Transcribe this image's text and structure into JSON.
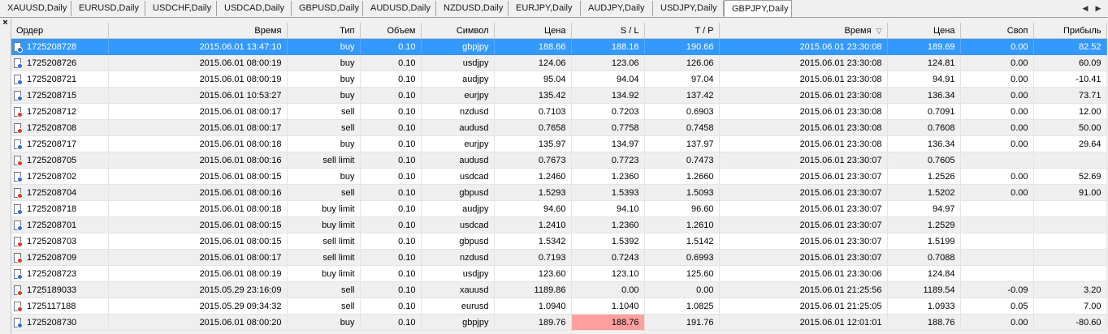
{
  "tabs": [
    "XAUUSD,Daily",
    "EURUSD,Daily",
    "USDCHF,Daily",
    "USDCAD,Daily",
    "GBPUSD,Daily",
    "AUDUSD,Daily",
    "NZDUSD,Daily",
    "EURJPY,Daily",
    "AUDJPY,Daily",
    "USDJPY,Daily",
    "GBPJPY,Daily"
  ],
  "active_tab": "GBPJPY,Daily",
  "nav": {
    "left": "◀",
    "right": "▶"
  },
  "close_glyph": "×",
  "columns": [
    "Ордер",
    "Время",
    "Тип",
    "Объем",
    "Символ",
    "Цена",
    "S / L",
    "T / P",
    "Время",
    "Цена",
    "Своп",
    "Прибыль"
  ],
  "sort_indicator": "▽",
  "colors": {
    "selected_row": "#3399ff",
    "sl_highlight": "#ff9f9f",
    "buy_icon": "#2c6fd8",
    "sell_icon": "#e03a1e"
  },
  "rows": [
    {
      "order": "1725208728",
      "time": "2015.06.01 13:47:10",
      "type": "buy",
      "volume": "0.10",
      "symbol": "gbpjpy",
      "price": "188.66",
      "sl": "188.16",
      "tp": "190.66",
      "time2": "2015.06.01 23:30:08",
      "price2": "189.69",
      "swap": "0.00",
      "profit": "82.52"
    },
    {
      "order": "1725208726",
      "time": "2015.06.01 08:00:19",
      "type": "buy",
      "volume": "0.10",
      "symbol": "usdjpy",
      "price": "124.06",
      "sl": "123.06",
      "tp": "126.06",
      "time2": "2015.06.01 23:30:08",
      "price2": "124.81",
      "swap": "0.00",
      "profit": "60.09"
    },
    {
      "order": "1725208721",
      "time": "2015.06.01 08:00:19",
      "type": "buy",
      "volume": "0.10",
      "symbol": "audjpy",
      "price": "95.04",
      "sl": "94.04",
      "tp": "97.04",
      "time2": "2015.06.01 23:30:08",
      "price2": "94.91",
      "swap": "0.00",
      "profit": "-10.41"
    },
    {
      "order": "1725208715",
      "time": "2015.06.01 10:53:27",
      "type": "buy",
      "volume": "0.10",
      "symbol": "eurjpy",
      "price": "135.42",
      "sl": "134.92",
      "tp": "137.42",
      "time2": "2015.06.01 23:30:08",
      "price2": "136.34",
      "swap": "0.00",
      "profit": "73.71"
    },
    {
      "order": "1725208712",
      "time": "2015.06.01 08:00:17",
      "type": "sell",
      "volume": "0.10",
      "symbol": "nzdusd",
      "price": "0.7103",
      "sl": "0.7203",
      "tp": "0.6903",
      "time2": "2015.06.01 23:30:08",
      "price2": "0.7091",
      "swap": "0.00",
      "profit": "12.00"
    },
    {
      "order": "1725208708",
      "time": "2015.06.01 08:00:17",
      "type": "sell",
      "volume": "0.10",
      "symbol": "audusd",
      "price": "0.7658",
      "sl": "0.7758",
      "tp": "0.7458",
      "time2": "2015.06.01 23:30:08",
      "price2": "0.7608",
      "swap": "0.00",
      "profit": "50.00"
    },
    {
      "order": "1725208717",
      "time": "2015.06.01 08:00:18",
      "type": "buy",
      "volume": "0.10",
      "symbol": "eurjpy",
      "price": "135.97",
      "sl": "134.97",
      "tp": "137.97",
      "time2": "2015.06.01 23:30:08",
      "price2": "136.34",
      "swap": "0.00",
      "profit": "29.64"
    },
    {
      "order": "1725208705",
      "time": "2015.06.01 08:00:16",
      "type": "sell limit",
      "volume": "0.10",
      "symbol": "audusd",
      "price": "0.7673",
      "sl": "0.7723",
      "tp": "0.7473",
      "time2": "2015.06.01 23:30:07",
      "price2": "0.7605",
      "swap": "",
      "profit": ""
    },
    {
      "order": "1725208702",
      "time": "2015.06.01 08:00:15",
      "type": "buy",
      "volume": "0.10",
      "symbol": "usdcad",
      "price": "1.2460",
      "sl": "1.2360",
      "tp": "1.2660",
      "time2": "2015.06.01 23:30:07",
      "price2": "1.2526",
      "swap": "0.00",
      "profit": "52.69"
    },
    {
      "order": "1725208704",
      "time": "2015.06.01 08:00:16",
      "type": "sell",
      "volume": "0.10",
      "symbol": "gbpusd",
      "price": "1.5293",
      "sl": "1.5393",
      "tp": "1.5093",
      "time2": "2015.06.01 23:30:07",
      "price2": "1.5202",
      "swap": "0.00",
      "profit": "91.00"
    },
    {
      "order": "1725208718",
      "time": "2015.06.01 08:00:18",
      "type": "buy limit",
      "volume": "0.10",
      "symbol": "audjpy",
      "price": "94.60",
      "sl": "94.10",
      "tp": "96.60",
      "time2": "2015.06.01 23:30:07",
      "price2": "94.97",
      "swap": "",
      "profit": ""
    },
    {
      "order": "1725208701",
      "time": "2015.06.01 08:00:15",
      "type": "buy limit",
      "volume": "0.10",
      "symbol": "usdcad",
      "price": "1.2410",
      "sl": "1.2360",
      "tp": "1.2610",
      "time2": "2015.06.01 23:30:07",
      "price2": "1.2529",
      "swap": "",
      "profit": ""
    },
    {
      "order": "1725208703",
      "time": "2015.06.01 08:00:15",
      "type": "sell limit",
      "volume": "0.10",
      "symbol": "gbpusd",
      "price": "1.5342",
      "sl": "1.5392",
      "tp": "1.5142",
      "time2": "2015.06.01 23:30:07",
      "price2": "1.5199",
      "swap": "",
      "profit": ""
    },
    {
      "order": "1725208709",
      "time": "2015.06.01 08:00:17",
      "type": "sell limit",
      "volume": "0.10",
      "symbol": "nzdusd",
      "price": "0.7193",
      "sl": "0.7243",
      "tp": "0.6993",
      "time2": "2015.06.01 23:30:07",
      "price2": "0.7088",
      "swap": "",
      "profit": ""
    },
    {
      "order": "1725208723",
      "time": "2015.06.01 08:00:19",
      "type": "buy limit",
      "volume": "0.10",
      "symbol": "usdjpy",
      "price": "123.60",
      "sl": "123.10",
      "tp": "125.60",
      "time2": "2015.06.01 23:30:06",
      "price2": "124.84",
      "swap": "",
      "profit": ""
    },
    {
      "order": "1725189033",
      "time": "2015.05.29 23:16:09",
      "type": "sell",
      "volume": "0.10",
      "symbol": "xauusd",
      "price": "1189.86",
      "sl": "0.00",
      "tp": "0.00",
      "time2": "2015.06.01 21:25:56",
      "price2": "1189.54",
      "swap": "-0.09",
      "profit": "3.20"
    },
    {
      "order": "1725117188",
      "time": "2015.05.29 09:34:32",
      "type": "sell",
      "volume": "0.10",
      "symbol": "eurusd",
      "price": "1.0940",
      "sl": "1.1040",
      "tp": "1.0825",
      "time2": "2015.06.01 21:25:05",
      "price2": "1.0933",
      "swap": "0.05",
      "profit": "7.00"
    },
    {
      "order": "1725208730",
      "time": "2015.06.01 08:00:20",
      "type": "buy",
      "volume": "0.10",
      "symbol": "gbpjpy",
      "price": "189.76",
      "sl": "188.76",
      "tp": "191.76",
      "time2": "2015.06.01 12:01:01",
      "price2": "188.76",
      "swap": "0.00",
      "profit": "-80.60"
    }
  ]
}
